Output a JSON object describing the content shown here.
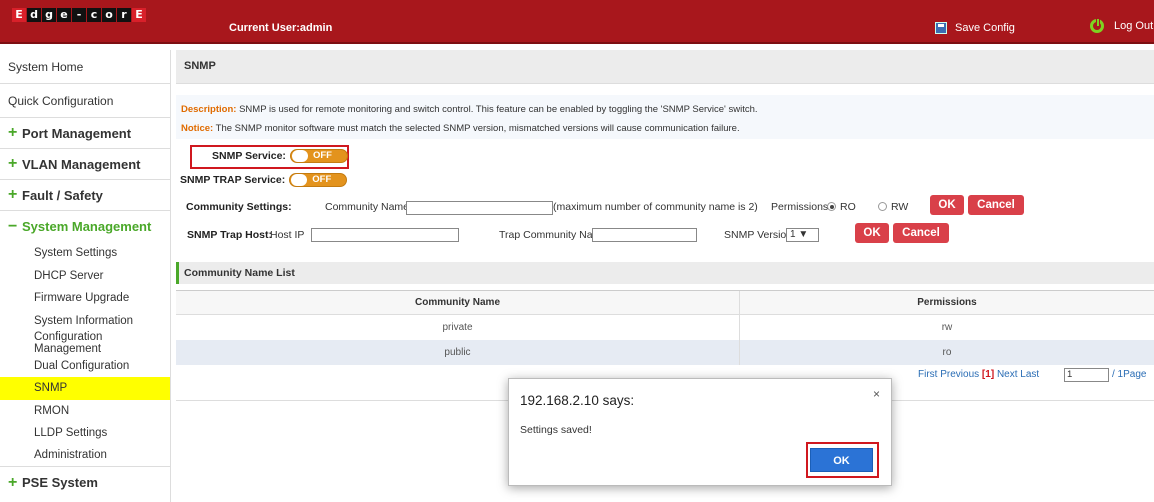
{
  "header": {
    "logo_letters": [
      "E",
      "d",
      "g",
      "e",
      "-",
      "c",
      "o",
      "r",
      "E"
    ],
    "current_user": "Current User:admin",
    "save_config": "Save Config",
    "logout": "Log Out",
    "colors": {
      "bar": "#a8171c",
      "power_icon": "#7ed321"
    }
  },
  "sidebar": {
    "top_items": [
      "System Home",
      "Quick Configuration"
    ],
    "groups": {
      "port": "Port Management",
      "vlan": "VLAN Management",
      "fault": "Fault / Safety",
      "system": "System Management",
      "pse": "PSE System"
    },
    "group_markers": {
      "collapsed": "+",
      "expanded": "−"
    },
    "sub_items": [
      "System Settings",
      "DHCP Server",
      "Firmware Upgrade",
      "System Information",
      "Configuration Management",
      "Dual Configuration",
      "SNMP",
      "RMON",
      "LLDP Settings",
      "Administration"
    ],
    "selected": "SNMP"
  },
  "page": {
    "title": "SNMP",
    "description_label": "Description:",
    "description_text": " SNMP is used for remote monitoring and switch control. This feature can be enabled by toggling the 'SNMP Service' switch.",
    "notice_label": "Notice:",
    "notice_text": " The SNMP monitor software must match the selected SNMP version, mismatched versions will cause communication failure.",
    "snmp_service_label": "SNMP Service:",
    "snmp_service_state": "OFF",
    "snmp_trap_label": "SNMP TRAP Service:",
    "snmp_trap_state": "OFF",
    "community": {
      "label": "Community Settings:",
      "name_label": "Community Name",
      "name_value": "",
      "hint": "(maximum number of community name is 2)",
      "permissions_label": "Permissions",
      "ro": "RO",
      "rw": "RW",
      "selected_permission": "RO",
      "ok": "OK",
      "cancel": "Cancel"
    },
    "trap_host": {
      "label": "SNMP Trap Host:",
      "host_ip_label": "Host IP",
      "host_ip_value": "",
      "community_label": "Trap Community Name",
      "community_value": "",
      "version_label": "SNMP Version",
      "version_value": "1 ▼",
      "ok": "OK",
      "cancel": "Cancel"
    },
    "list": {
      "title": "Community Name List",
      "columns": [
        "Community Name",
        "Permissions"
      ],
      "rows": [
        {
          "name": "private",
          "perm": "rw"
        },
        {
          "name": "public",
          "perm": "ro"
        }
      ]
    },
    "pager": {
      "first": "First",
      "previous": "Previous",
      "current": "[1]",
      "next": "Next",
      "last": "Last",
      "page_input": "1",
      "total": "/ 1Page"
    }
  },
  "dialog": {
    "title": "192.168.2.10 says:",
    "close": "×",
    "message": "Settings saved!",
    "ok": "OK"
  }
}
